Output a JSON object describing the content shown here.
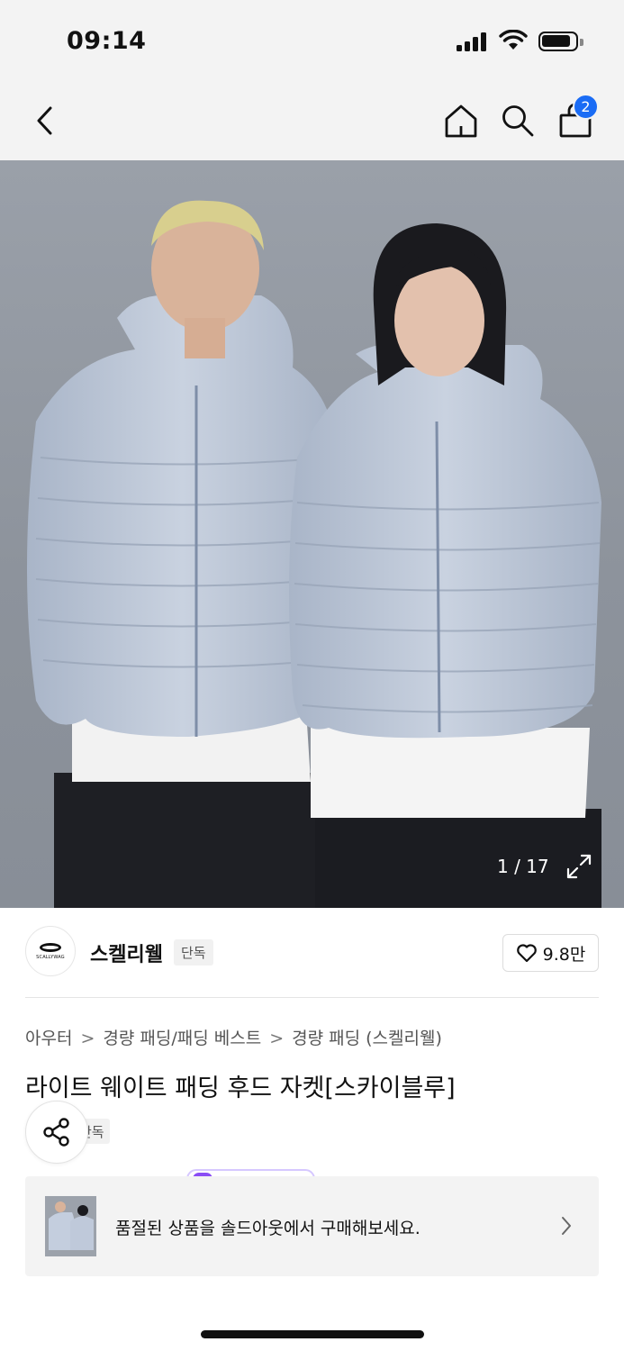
{
  "status": {
    "time": "09:14"
  },
  "nav": {
    "cart_count": "2"
  },
  "gallery": {
    "counter": "1 / 17"
  },
  "brand": {
    "name": "스켈리웰",
    "logo_text": "SCALLYWAG",
    "tag": "단독",
    "likes": "9.8만"
  },
  "breadcrumb": {
    "items": [
      "아우터",
      "경량 패딩/패딩 베스트",
      "경량 패딩 (스켈리웰)"
    ]
  },
  "product": {
    "title": "라이트 웨이트 패딩 후드 자켓[스카이블루]",
    "tag_partial": "단독"
  },
  "banner": {
    "text": "품절된 상품을 솔드아웃에서 구매해보세요."
  },
  "colors": {
    "badge": "#1a6cf5",
    "jacket": "#b8c3d4",
    "accent_purple": "#8a4df5"
  }
}
